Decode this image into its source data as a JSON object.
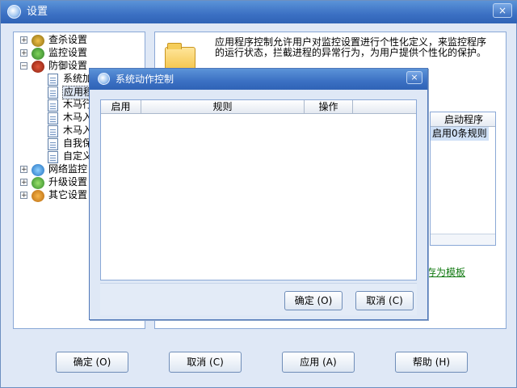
{
  "window": {
    "title": "设置",
    "close_glyph": "×"
  },
  "tree": {
    "items": [
      {
        "label": "查杀设置",
        "icon": "search-shield-icon",
        "expander": "+"
      },
      {
        "label": "监控设置",
        "icon": "umbrella-icon",
        "expander": "+"
      },
      {
        "label": "防御设置",
        "icon": "shield-hand-icon",
        "expander": "−"
      },
      {
        "label": "系统加",
        "icon": "doc-icon"
      },
      {
        "label": "应用程",
        "icon": "doc-icon",
        "selected": true
      },
      {
        "label": "木马行",
        "icon": "doc-icon"
      },
      {
        "label": "木马入",
        "icon": "doc-icon"
      },
      {
        "label": "木马入",
        "icon": "doc-icon"
      },
      {
        "label": "自我保",
        "icon": "doc-icon"
      },
      {
        "label": "自定义",
        "icon": "doc-icon"
      },
      {
        "label": "网络监控",
        "icon": "globe-icon",
        "expander": "+"
      },
      {
        "label": "升级设置",
        "icon": "upgrade-icon",
        "expander": "+"
      },
      {
        "label": "其它设置",
        "icon": "gear-icon",
        "expander": "+"
      }
    ]
  },
  "right": {
    "description": "应用程序控制允许用户对监控设置进行个性化定义，来监控程序的运行状态，拦截进程的异常行为，为用户提供个性化的保护。",
    "list_header": "启动程序",
    "list_cell": "启用0条规则",
    "save_link": "存为模板"
  },
  "footer": {
    "ok": "确定 (O)",
    "cancel": "取消 (C)",
    "apply": "应用 (A)",
    "help": "帮助 (H)"
  },
  "dialog": {
    "title": "系统动作控制",
    "close_glyph": "×",
    "columns": [
      "启用",
      "规则",
      "操作"
    ],
    "ok": "确定 (O)",
    "cancel": "取消 (C)"
  },
  "colors": {
    "titlebar": "#3b70c3",
    "panel": "#dfe8f6",
    "border": "#8aa8d6",
    "link": "#127a12"
  }
}
